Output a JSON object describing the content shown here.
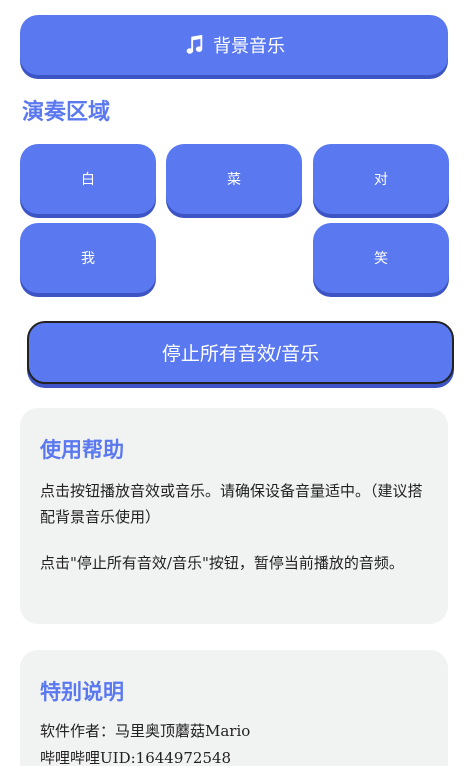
{
  "bgm_button": {
    "label": "背景音乐",
    "icon": "music-note-icon"
  },
  "play_section": {
    "title": "演奏区域",
    "pads": [
      {
        "label": "白"
      },
      {
        "label": "菜"
      },
      {
        "label": "对"
      },
      {
        "label": "我"
      },
      {
        "label": "笑"
      }
    ]
  },
  "stop_button": {
    "label": "停止所有音效/音乐"
  },
  "help": {
    "title": "使用帮助",
    "paragraph1": "点击按钮播放音效或音乐。请确保设备音量适中。（建议搭配背景音乐使用）",
    "paragraph2": "点击\"停止所有音效/音乐\"按钮，暂停当前播放的音频。"
  },
  "note": {
    "title": "特别说明",
    "author": "软件作者：马里奥顶蘑菇Mario",
    "uid": "哔哩哔哩UID:1644972548"
  },
  "colors": {
    "accent": "#5a78f0",
    "accent_shadow": "#3d55c4",
    "card_bg": "#f1f2f2",
    "text": "#222222"
  }
}
